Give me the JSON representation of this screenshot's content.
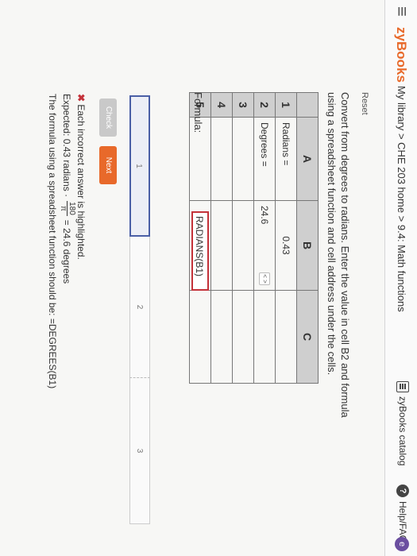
{
  "header": {
    "logo": "zyBooks",
    "breadcrumb": [
      "My library",
      "CHE 203 home",
      "9.4: Math functions"
    ],
    "catalog_label": "zyBooks catalog",
    "help_label": "Help/FAQ",
    "help_glyph": "?",
    "user_glyph": "e"
  },
  "activity": {
    "reset_label": "Reset",
    "prompt": "Convert from degrees to radians. Enter the value in cell B2 and formula using a spreadsheet function and cell address under the cells."
  },
  "sheet": {
    "columns": [
      "A",
      "B",
      "C"
    ],
    "rows": [
      "1",
      "2",
      "3",
      "4",
      "5"
    ],
    "a1": "Radians =",
    "b1": "0.43",
    "a2": "Degrees =",
    "b2": "24.6"
  },
  "formula": {
    "label": "Formula:",
    "value": "RADIANS(B1)"
  },
  "progress": {
    "segments": [
      "1",
      "2",
      "3"
    ]
  },
  "buttons": {
    "check": "Check",
    "next": "Next"
  },
  "feedback": {
    "line1": "Each incorrect answer is highlighted.",
    "expected_prefix": "Expected: 0.43 radians ·",
    "frac_num": "180",
    "frac_den": "π",
    "expected_suffix": "= 24.6 degrees",
    "line3": "The formula using a spreadsheet function should be: =DEGREES(B1)"
  }
}
